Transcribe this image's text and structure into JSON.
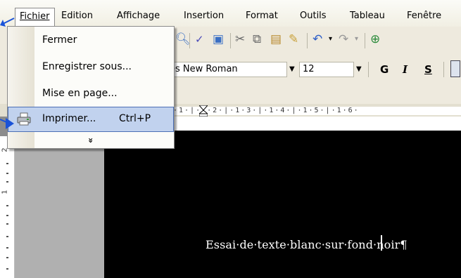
{
  "menu_bar": {
    "items": [
      {
        "label": "Fichier"
      },
      {
        "label": "Edition"
      },
      {
        "label": "Affichage"
      },
      {
        "label": "Insertion"
      },
      {
        "label": "Format"
      },
      {
        "label": "Outils"
      },
      {
        "label": "Tableau"
      },
      {
        "label": "Fenêtre"
      }
    ]
  },
  "file_menu": {
    "items": [
      {
        "label": "Fermer"
      },
      {
        "label": "Enregistrer sous..."
      },
      {
        "label": "Mise en page..."
      },
      {
        "label": "Imprimer...",
        "shortcut": "Ctrl+P"
      }
    ],
    "expand_glyph": "»"
  },
  "formatting_toolbar": {
    "font_name": "es New Roman",
    "font_size": "12",
    "bold": "G",
    "italic": "I",
    "underline": "S"
  },
  "ruler": {
    "text": "·1·|·1·2·|·1·3·|·1·4·|·1·5·|·1·6·"
  },
  "document": {
    "text": "Essai·de·texte·blanc·sur·fond·noir¶"
  },
  "colors": {
    "highlight": "#c1d2ee",
    "highlight_border": "#4c6fb5",
    "arrow": "#1a53d8",
    "doc_background": "#000000"
  }
}
